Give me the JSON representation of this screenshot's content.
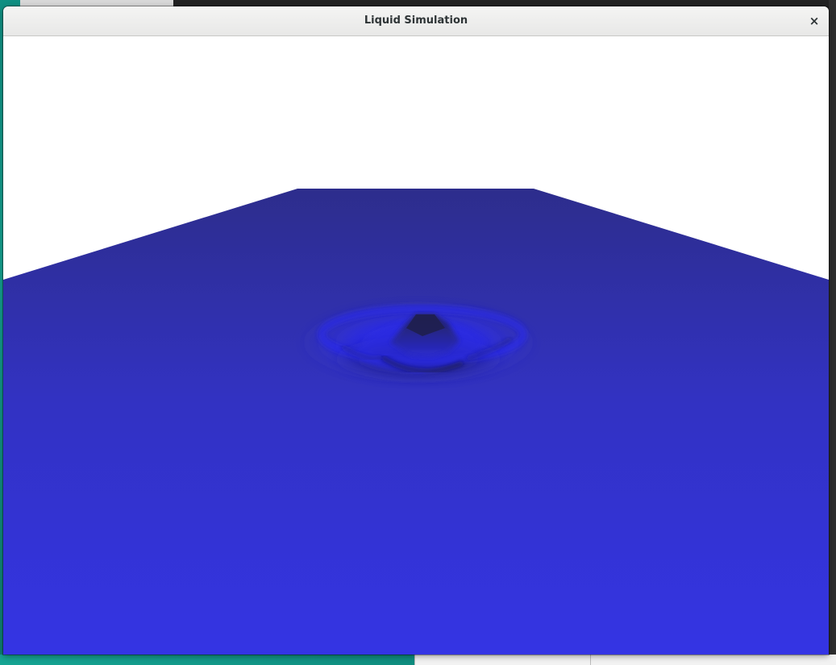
{
  "window": {
    "title": "Liquid Simulation",
    "close_glyph": "×",
    "close_icon": "close-icon"
  },
  "scene": {
    "background_color": "#ffffff",
    "liquid_color_far": "#2d2d8c",
    "liquid_color_near": "#3434e4",
    "ripple_highlight_color": "#2a2aff",
    "ripple_shadow_color": "#1a1a40"
  }
}
